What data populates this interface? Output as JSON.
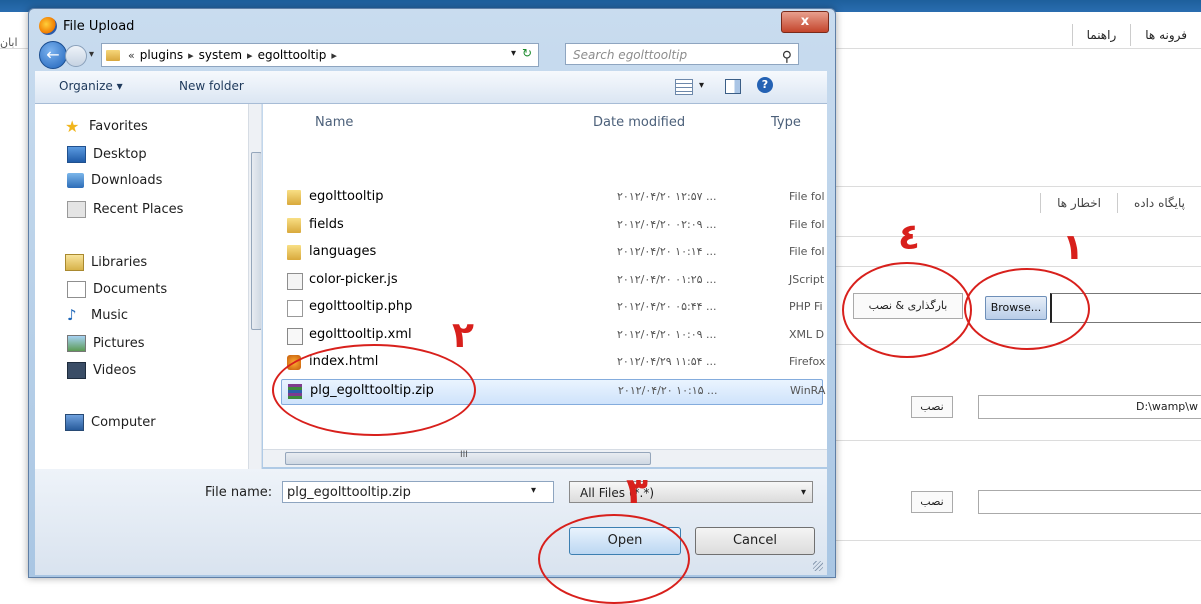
{
  "background": {
    "menu": [
      "فرونه ها",
      "راهنما"
    ],
    "tabs": [
      "پایگاه داده",
      "اخطار ها"
    ],
    "left_cut": "ابان",
    "browse_label": "Browse...",
    "upload_label": "بارگذاری & نصب",
    "install_label": "نصب",
    "path_value": "D:\\wamp\\w"
  },
  "dialog": {
    "title": "File Upload",
    "close_label": "x",
    "address": {
      "prefix": "«",
      "crumbs": [
        "plugins",
        "system",
        "egolttooltip"
      ],
      "separator": "▸"
    },
    "search_placeholder": "Search egolttooltip",
    "toolbar": {
      "organize": "Organize ▾",
      "new_folder": "New folder"
    },
    "nav": {
      "favorites": "Favorites",
      "desktop": "Desktop",
      "downloads": "Downloads",
      "recent": "Recent Places",
      "libraries": "Libraries",
      "documents": "Documents",
      "music": "Music",
      "pictures": "Pictures",
      "videos": "Videos",
      "computer": "Computer"
    },
    "columns": {
      "name": "Name",
      "date": "Date modified",
      "type": "Type"
    },
    "files": [
      {
        "name": "egolttooltip",
        "date": "۲۰۱۲/۰۴/۲۰ ۱۲:۵۷ ...",
        "type": "File fol",
        "icon": "folder-icon"
      },
      {
        "name": "fields",
        "date": "۲۰۱۲/۰۴/۲۰ ۰۲:۰۹ ...",
        "type": "File fol",
        "icon": "folder-icon"
      },
      {
        "name": "languages",
        "date": "۲۰۱۲/۰۴/۲۰ ۱۰:۱۴ ...",
        "type": "File fol",
        "icon": "folder-icon"
      },
      {
        "name": "color-picker.js",
        "date": "۲۰۱۲/۰۴/۲۰ ۰۱:۲۵ ...",
        "type": "JScript",
        "icon": "js-file-icon"
      },
      {
        "name": "egolttooltip.php",
        "date": "۲۰۱۲/۰۴/۲۰ ۰۵:۴۴ ...",
        "type": "PHP Fi",
        "icon": "php-file-icon"
      },
      {
        "name": "egolttooltip.xml",
        "date": "۲۰۱۲/۰۴/۲۰ ۱۰:۰۹ ...",
        "type": "XML D",
        "icon": "xml-file-icon"
      },
      {
        "name": "index.html",
        "date": "۲۰۱۲/۰۴/۲۹ ۱۱:۵۴ ...",
        "type": "Firefox",
        "icon": "html-file-icon"
      },
      {
        "name": "plg_egolttooltip.zip",
        "date": "۲۰۱۲/۰۴/۲۰ ۱۰:۱۵ ...",
        "type": "WinRA",
        "icon": "zip-file-icon"
      }
    ],
    "selected_index": 7,
    "file_name_label": "File name:",
    "file_name_value": "plg_egolttooltip.zip",
    "file_type_value": "All Files (*.*)",
    "open_label": "Open",
    "cancel_label": "Cancel",
    "scroll_marker": "III"
  },
  "annotations": [
    "۱",
    "۲",
    "۳",
    "٤"
  ],
  "colors": {
    "annotation": "#d8201c",
    "titlebar": "#c9dcef",
    "selection": "#cfe3fb"
  }
}
